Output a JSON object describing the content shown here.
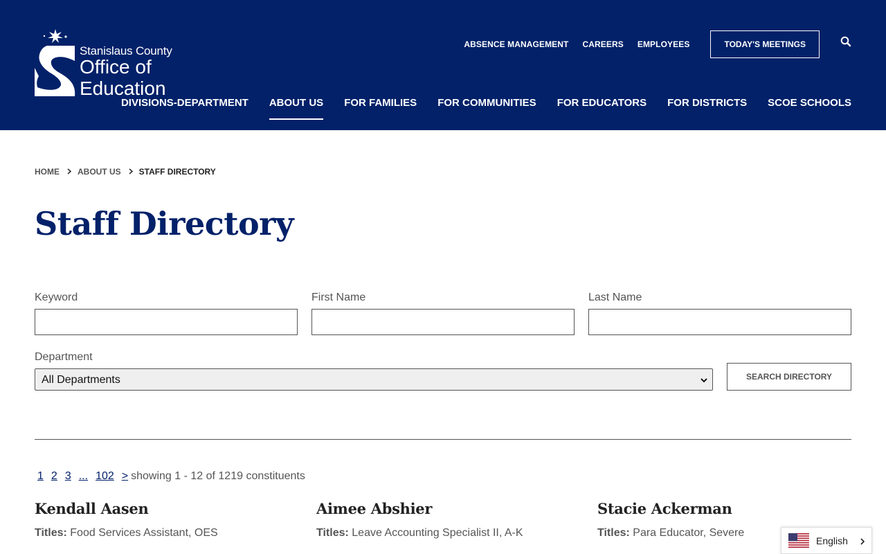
{
  "header": {
    "logo": {
      "line1": "Stanislaus County",
      "line2": "Office of",
      "line3": "Education"
    },
    "utility_nav": [
      "ABSENCE MANAGEMENT",
      "CAREERS",
      "EMPLOYEES"
    ],
    "meetings_button": "TODAY'S MEETINGS",
    "search_icon": "search-icon",
    "main_nav": [
      {
        "label": "DIVISIONS-DEPARTMENT",
        "active": false
      },
      {
        "label": "ABOUT US",
        "active": true
      },
      {
        "label": "FOR FAMILIES",
        "active": false
      },
      {
        "label": "FOR COMMUNITIES",
        "active": false
      },
      {
        "label": "FOR EDUCATORS",
        "active": false
      },
      {
        "label": "FOR DISTRICTS",
        "active": false
      },
      {
        "label": "SCOE SCHOOLS",
        "active": false
      }
    ]
  },
  "breadcrumb": [
    "HOME",
    "ABOUT US",
    "STAFF DIRECTORY"
  ],
  "page_title": "Staff Directory",
  "form": {
    "keyword_label": "Keyword",
    "keyword_value": "",
    "first_name_label": "First Name",
    "first_name_value": "",
    "last_name_label": "Last Name",
    "last_name_value": "",
    "department_label": "Department",
    "department_selected": "All Departments",
    "search_button": "SEARCH DIRECTORY"
  },
  "pagination": {
    "pages": [
      "1",
      "2",
      "3"
    ],
    "ellipsis": "...",
    "last_page": "102",
    "next": ">",
    "showing": "showing 1 - 12 of 1219 constituents"
  },
  "staff": [
    {
      "name": "Kendall Aasen",
      "titles_label": "Titles:",
      "title": "Food Services Assistant, OES"
    },
    {
      "name": "Aimee Abshier",
      "titles_label": "Titles:",
      "title": "Leave Accounting Specialist II, A-K"
    },
    {
      "name": "Stacie Ackerman",
      "titles_label": "Titles:",
      "title": "Para Educator, Severe"
    }
  ],
  "language_widget": {
    "label": "English",
    "flag_icon": "us-flag-icon"
  },
  "colors": {
    "brand_navy": "#022169",
    "text_gray": "#555555"
  }
}
